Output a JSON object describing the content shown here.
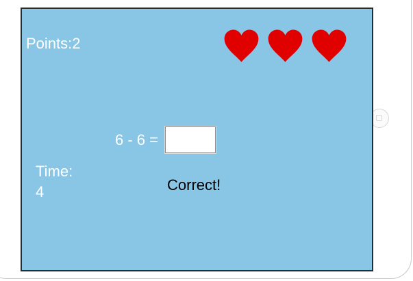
{
  "hud": {
    "points_label": "Points:2",
    "lives": 3,
    "time_label": "Time:",
    "time_value": "4"
  },
  "question": {
    "text": "6 - 6 =",
    "answer_value": ""
  },
  "feedback": {
    "text": "Correct!"
  },
  "colors": {
    "background": "#89c6e5",
    "heart": "#e00000",
    "label_text": "#ffffff",
    "feedback_text": "#000000"
  },
  "icons": {
    "life": "heart-icon",
    "device_home": "home-button-icon",
    "device_camera": "front-camera-icon"
  }
}
